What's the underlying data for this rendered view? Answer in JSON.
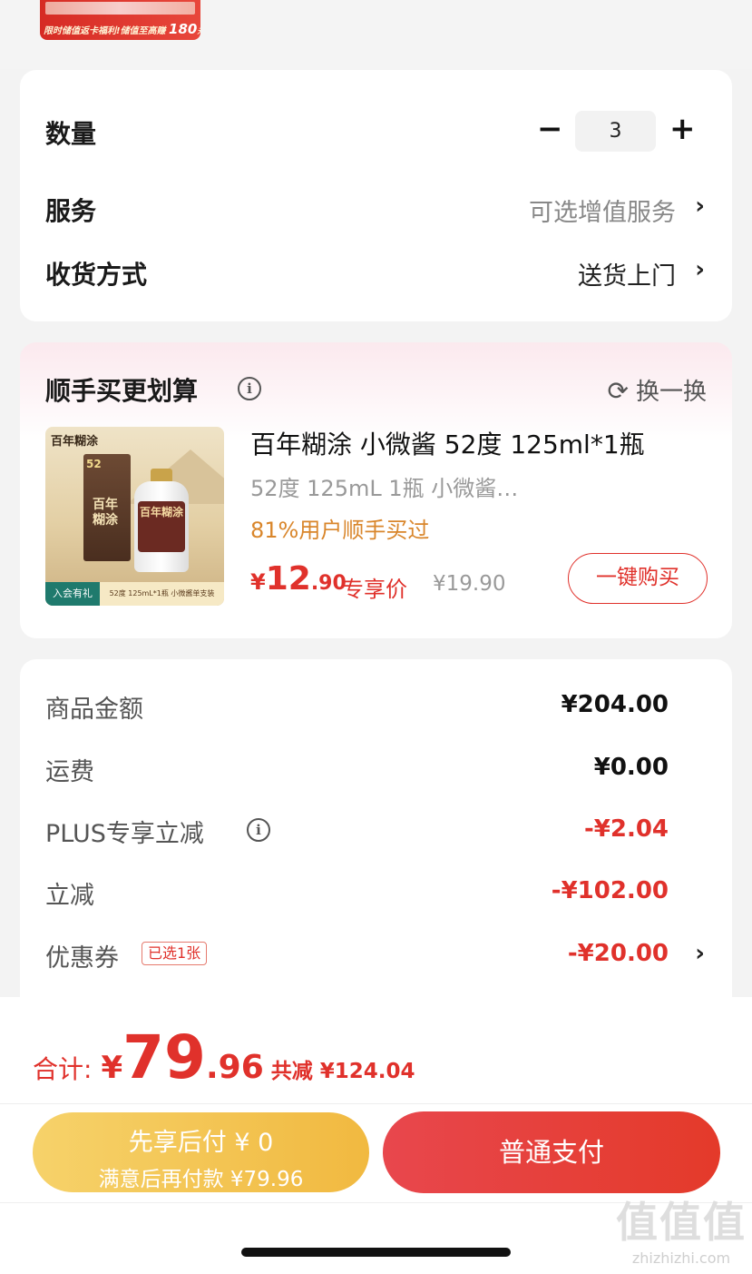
{
  "banner": {
    "text": "限时储值返卡福利!储值至高赚",
    "amount": "180",
    "unit": "元"
  },
  "options": {
    "quantity_label": "数量",
    "quantity_value": "3",
    "minus_symbol": "−",
    "plus_symbol": "+",
    "service_label": "服务",
    "service_value": "可选增值服务",
    "delivery_label": "收货方式",
    "delivery_value": "送货上门",
    "chevron": "›"
  },
  "recommend": {
    "title": "顺手买更划算",
    "info_symbol": "i",
    "refresh_label": "换一换",
    "refresh_symbol": "⟳",
    "product": {
      "image_brand": "百年糊涂",
      "image_box_number": "52",
      "image_box_text": "百年糊涂",
      "image_bottle_text": "百年糊涂",
      "image_join_text": "入会有礼",
      "image_caption": "52度 125mL*1瓶 小微酱单支装",
      "title": "百年糊涂 小微酱 52度 125ml*1瓶",
      "subtitle": "52度 125mL 1瓶 小微酱…",
      "hint": "81%用户顺手买过",
      "price_currency": "¥",
      "price_int": "12",
      "price_dec": ".90",
      "price_tag": "专享价",
      "orig_price": "¥19.90",
      "buy_label": "一键购买"
    }
  },
  "summary": {
    "rows": [
      {
        "label": "商品金额",
        "value": "¥204.00"
      },
      {
        "label": "运费",
        "value": "¥0.00"
      },
      {
        "label": "PLUS专享立减",
        "value": "-¥2.04"
      },
      {
        "label": "立减",
        "value": "-¥102.00"
      },
      {
        "label": "优惠券",
        "value": "-¥20.00"
      }
    ],
    "coupon_badge": "已选1张",
    "info_symbol": "i",
    "chevron": "›"
  },
  "footer": {
    "total_label": "合计:",
    "total_currency": "¥",
    "total_int": "79",
    "total_dec": ".96",
    "total_saved": "共减 ¥124.04",
    "pay_later_line1": "先享后付 ¥ 0",
    "pay_later_line2": "满意后再付款 ¥79.96",
    "pay_normal": "普通支付"
  },
  "watermark": {
    "logo": "值值值",
    "url": "zhizhizhi.com"
  },
  "colors": {
    "accent": "#e0312b",
    "gold": "#f1b940",
    "hint": "#d9862b"
  }
}
